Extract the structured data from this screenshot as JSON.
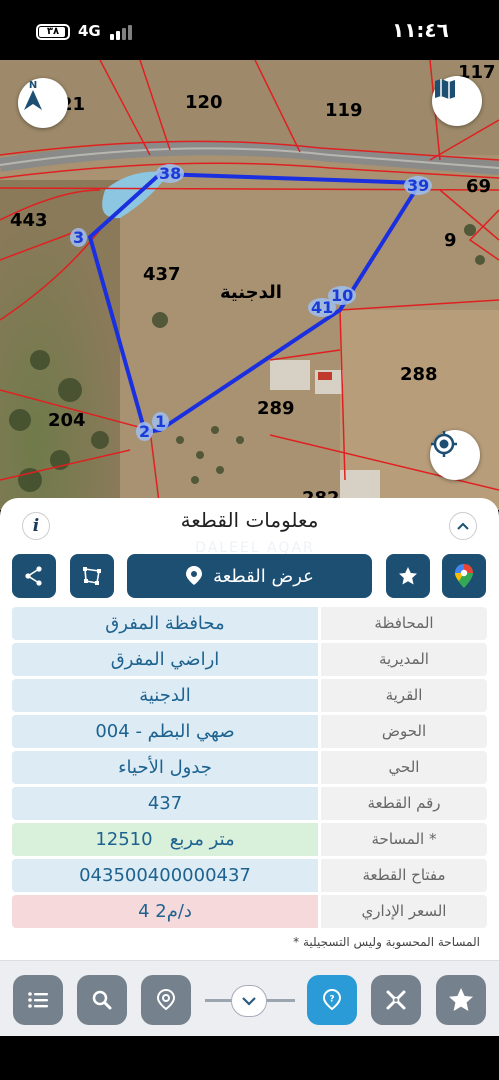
{
  "status": {
    "time": "١١:٤٦",
    "network": "4G",
    "battery": "٣٨"
  },
  "map": {
    "parcel_labels": [
      "117",
      "21",
      "120",
      "119",
      "443",
      "69",
      "9",
      "437",
      "288",
      "289",
      "204",
      "282"
    ],
    "area_name": "الدجنية",
    "vertices": [
      "38",
      "39",
      "3",
      "10",
      "41",
      "1",
      "2"
    ],
    "icons": {
      "compass": "north-compass-icon",
      "layers": "map-layers-icon",
      "locate": "my-location-icon"
    }
  },
  "panel": {
    "title": "معلومات القطعة",
    "watermark": "DALEEL AQAR",
    "info_label": "i",
    "actions": {
      "show_parcel": "عرض القطعة"
    },
    "rows": [
      {
        "label": "المحافظة",
        "value": "محافظة المفرق",
        "tone": "blue"
      },
      {
        "label": "المديرية",
        "value": "اراضي المفرق",
        "tone": "blue"
      },
      {
        "label": "القرية",
        "value": "الدجنية",
        "tone": "blue"
      },
      {
        "label": "الحوض",
        "value": "صهي البطم - 004",
        "tone": "blue"
      },
      {
        "label": "الحي",
        "value": "جدول الأحياء",
        "tone": "blue"
      },
      {
        "label": "رقم القطعة",
        "value": "437",
        "tone": "blue"
      },
      {
        "label": "المساحة *",
        "value": "12510   متر مربع",
        "tone": "green"
      },
      {
        "label": "مفتاح القطعة",
        "value": "043500400000437",
        "tone": "blue"
      },
      {
        "label": "السعر الإداري",
        "value": "4 د/م2",
        "tone": "red"
      }
    ],
    "note": "* المساحة المحسوبة وليس التسجيلية"
  },
  "colors": {
    "accent": "#1d4f73",
    "active": "#2a9bd6",
    "parcel_outline": "#1a2fe0",
    "boundary": "#e02020"
  }
}
